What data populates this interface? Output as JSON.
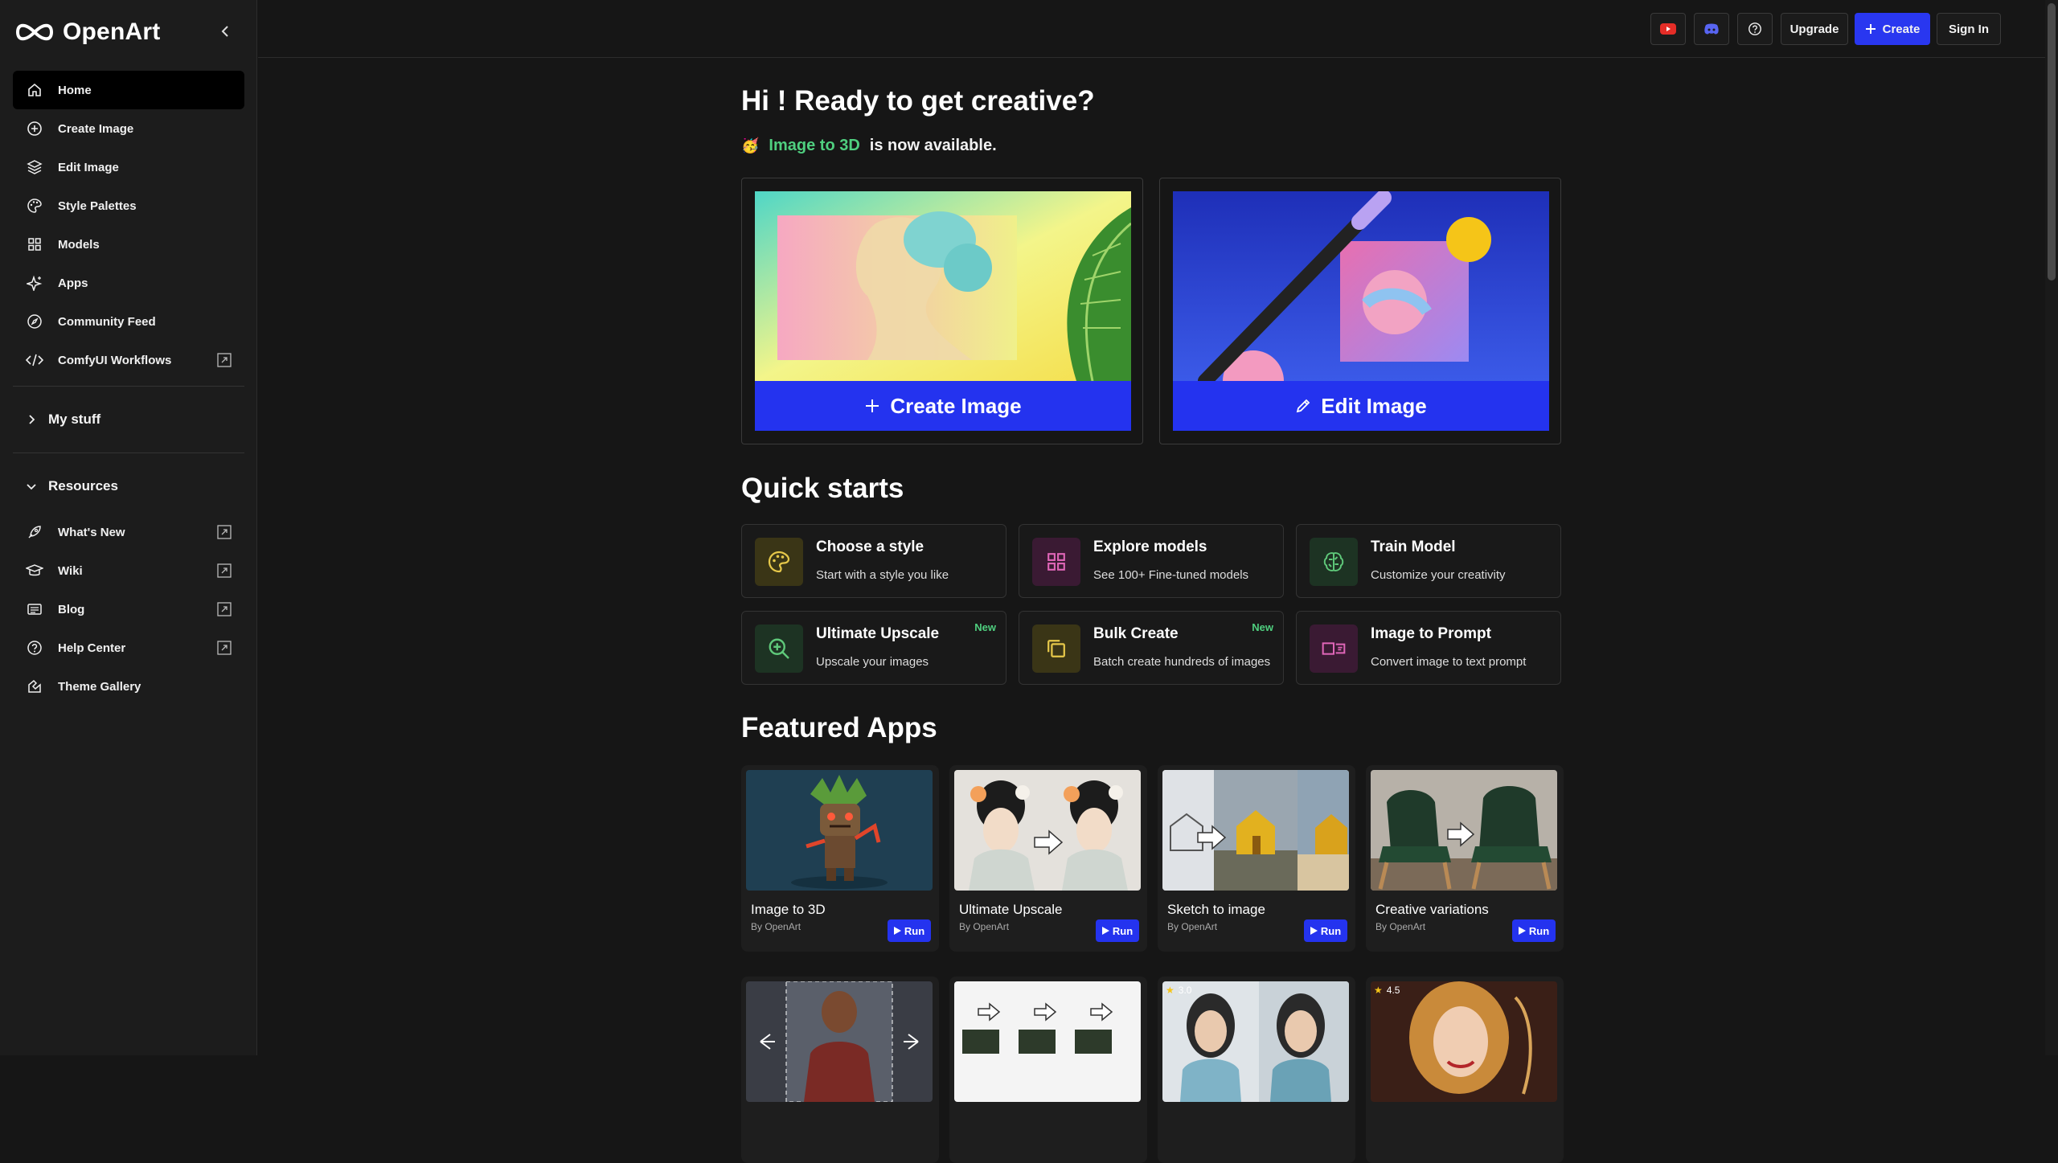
{
  "brand": {
    "name": "OpenArt"
  },
  "sidebar": {
    "nav": [
      {
        "label": "Home",
        "icon": "home-icon"
      },
      {
        "label": "Create Image",
        "icon": "plus-circle-icon"
      },
      {
        "label": "Edit Image",
        "icon": "layers-icon"
      },
      {
        "label": "Style Palettes",
        "icon": "palette-icon"
      },
      {
        "label": "Models",
        "icon": "grid-icon"
      },
      {
        "label": "Apps",
        "icon": "sparkle-icon"
      },
      {
        "label": "Community Feed",
        "icon": "compass-icon"
      },
      {
        "label": "ComfyUI Workflows",
        "icon": "code-icon"
      }
    ],
    "my_stuff": "My stuff",
    "resources": "Resources",
    "resource_items": [
      {
        "label": "What's New",
        "icon": "rocket-icon"
      },
      {
        "label": "Wiki",
        "icon": "graduation-cap-icon"
      },
      {
        "label": "Blog",
        "icon": "newspaper-icon"
      },
      {
        "label": "Help Center",
        "icon": "help-circle-icon"
      },
      {
        "label": "Theme Gallery",
        "icon": "theme-icon"
      }
    ]
  },
  "topbar": {
    "upgrade": "Upgrade",
    "create": "Create",
    "sign_in": "Sign In",
    "youtube_color": "#e52d27",
    "discord_color": "#5865f2"
  },
  "main": {
    "greeting": "Hi ! Ready to get creative?",
    "announce_link": "Image to 3D",
    "announce_rest": "is now available.",
    "hero_create": "Create Image",
    "hero_edit": "Edit Image",
    "quick_starts_title": "Quick starts",
    "quick_starts": [
      {
        "title": "Choose a style",
        "sub": "Start with a style you like",
        "icon": "palette-icon",
        "new": ""
      },
      {
        "title": "Explore models",
        "sub": "See 100+ Fine-tuned models",
        "icon": "grid-icon",
        "new": ""
      },
      {
        "title": "Train Model",
        "sub": "Customize your creativity",
        "icon": "brain-icon",
        "new": ""
      },
      {
        "title": "Ultimate Upscale",
        "sub": "Upscale your images",
        "icon": "zoom-in-icon",
        "new": "New"
      },
      {
        "title": "Bulk Create",
        "sub": "Batch create hundreds of images",
        "icon": "copy-icon",
        "new": "New"
      },
      {
        "title": "Image to Prompt",
        "sub": "Convert image to text prompt",
        "icon": "image-to-text-icon",
        "new": ""
      }
    ],
    "featured_title": "Featured Apps",
    "apps": [
      {
        "title": "Image to 3D",
        "by": "By OpenArt",
        "run": "Run"
      },
      {
        "title": "Ultimate Upscale",
        "by": "By OpenArt",
        "run": "Run"
      },
      {
        "title": "Sketch to image",
        "by": "By OpenArt",
        "run": "Run"
      },
      {
        "title": "Creative variations",
        "by": "By OpenArt",
        "run": "Run"
      }
    ],
    "row2_ratings": [
      "3.0",
      "4.5"
    ]
  },
  "colors": {
    "accent": "#2433ef",
    "new_badge": "#4fcf7f",
    "background": "#161616",
    "sidebar": "#1c1c1c"
  }
}
